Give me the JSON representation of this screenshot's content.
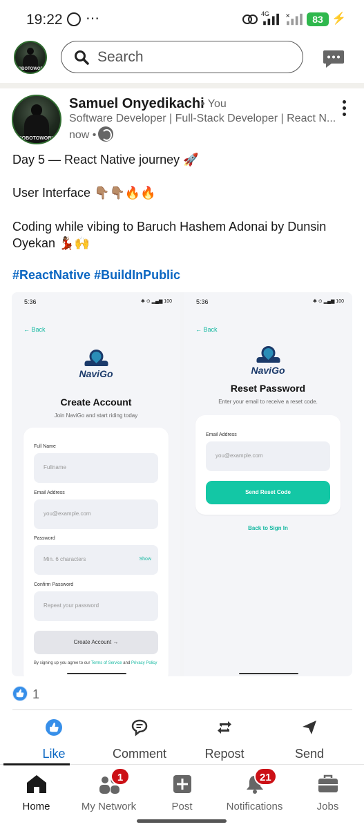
{
  "status_bar": {
    "time": "19:22",
    "more": "⋯",
    "network": "4G",
    "battery": "83"
  },
  "top_bar": {
    "avatar_text": "ROBOTOWORK",
    "search_placeholder": "Search"
  },
  "post": {
    "author_name": "Samuel Onyedikachi",
    "author_suffix": "• You",
    "headline": "Software Developer | Full-Stack Developer | React N...",
    "time_ago": "now •",
    "text_line1": "Day 5 — React Native journey 🚀",
    "text_line2": "User Interface 👇🏽👇🏽🔥🔥",
    "text_line3": "Coding while vibing to Baruch Hashem Adonai by Dunsin Oyekan 💃🏾🙌",
    "hashtags": "#ReactNative #BuildInPublic",
    "reaction_count": "1"
  },
  "embedded": {
    "left": {
      "time": "5:36",
      "icons": "✱ ⊙ ▂▄▆ 100",
      "back": "← Back",
      "logo": "NaviGo",
      "title": "Create Account",
      "subtitle": "Join NaviGo and start riding today",
      "full_name_label": "Full Name",
      "full_name_ph": "Fullname",
      "email_label": "Email Address",
      "email_ph": "you@example.com",
      "password_label": "Password",
      "password_ph": "Min. 6 characters",
      "show": "Show",
      "confirm_label": "Confirm Password",
      "confirm_ph": "Repeat your password",
      "button": "Create Account →",
      "terms_pre": "By signing up you agree to our ",
      "terms_link": "Terms of Service",
      "terms_mid": " and ",
      "privacy_link": "Privacy Policy"
    },
    "right": {
      "time": "5:36",
      "icons": "✱ ⊙ ▂▄▆ 100",
      "back": "← Back",
      "logo": "NaviGo",
      "title": "Reset Password",
      "subtitle": "Enter your email to receive a reset code.",
      "email_label": "Email Address",
      "email_ph": "you@example.com",
      "button": "Send Reset Code",
      "back_to_signin": "Back to Sign In"
    }
  },
  "actions": [
    {
      "label": "Like"
    },
    {
      "label": "Comment"
    },
    {
      "label": "Repost"
    },
    {
      "label": "Send"
    }
  ],
  "nav": [
    {
      "label": "Home"
    },
    {
      "label": "My Network",
      "badge": "1"
    },
    {
      "label": "Post"
    },
    {
      "label": "Notifications",
      "badge": "21"
    },
    {
      "label": "Jobs"
    }
  ],
  "colors": {
    "brand_blue": "#0a66c2",
    "badge_red": "#cc1016",
    "teal": "#13c7a5",
    "battery_green": "#2fb84d"
  }
}
